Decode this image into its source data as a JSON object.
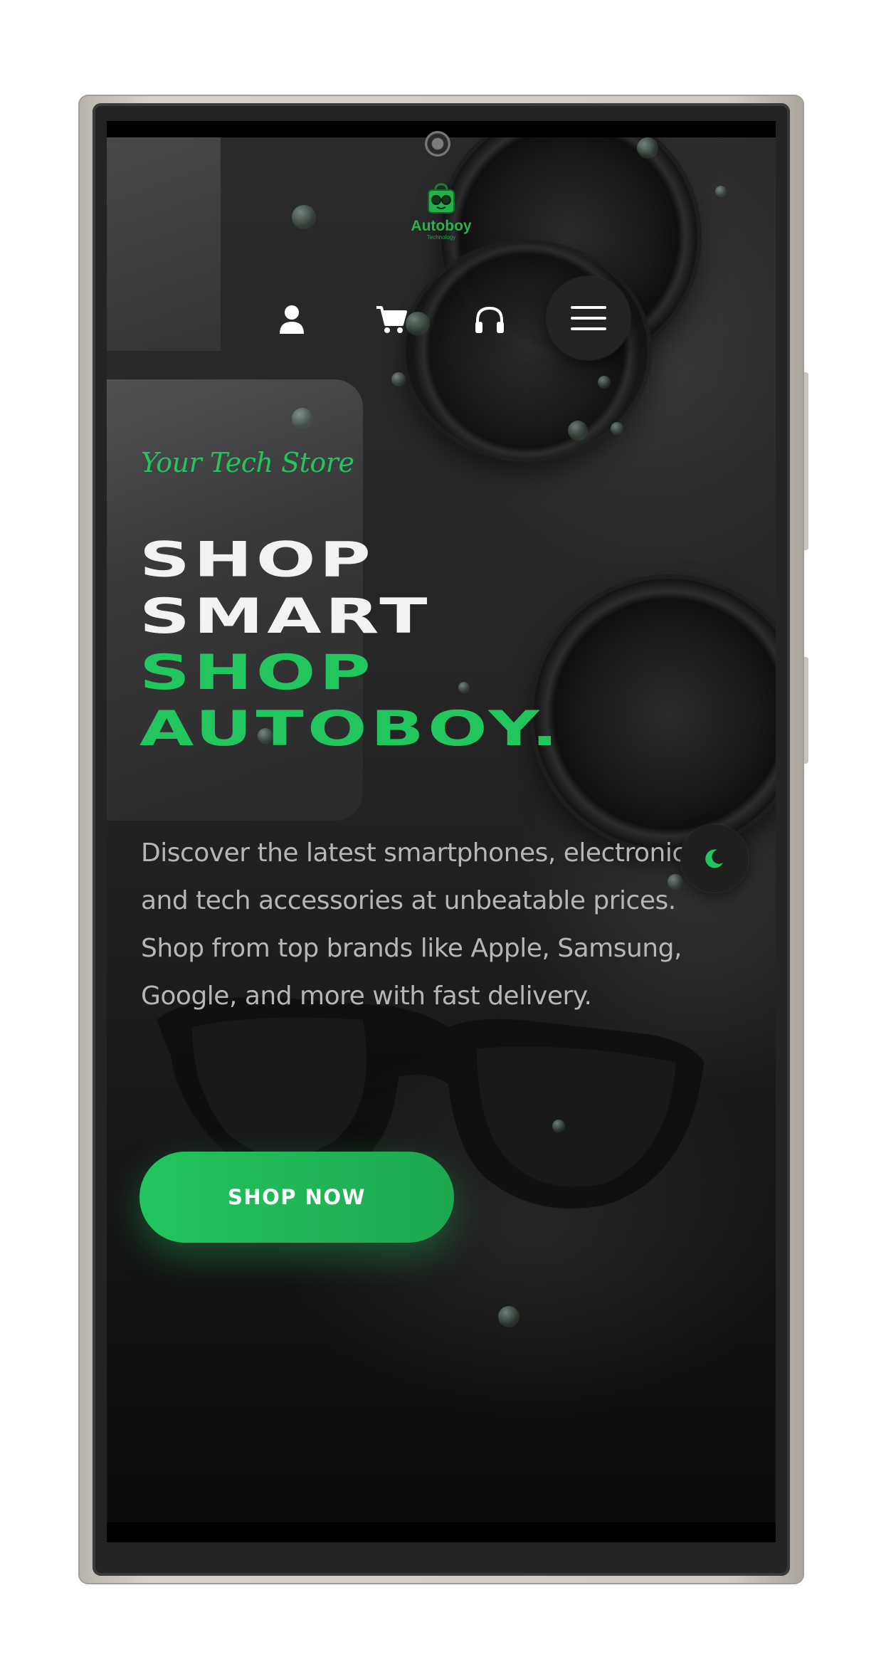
{
  "header": {
    "logo_name": "Autoboy",
    "logo_subtitle": "Technology",
    "icons": [
      "user-icon",
      "cart-icon",
      "headphones-icon",
      "menu-icon"
    ]
  },
  "hero": {
    "tagline": "Your Tech Store",
    "headline_line1": "SHOP",
    "headline_line2": "SMART",
    "headline_line3": "SHOP",
    "headline_line4": "AUTOBOY.",
    "description": "Discover the latest smartphones, electronics, and tech accessories at unbeatable prices. Shop from top brands like Apple, Samsung, Google, and more with fast delivery.",
    "cta_label": "SHOP NOW"
  },
  "theme_toggle": {
    "icon": "moon-icon"
  },
  "colors": {
    "accent": "#22c55e",
    "background": "#1a1a1a",
    "text_primary": "#f2f2f2",
    "text_secondary": "#b6b6b6"
  }
}
